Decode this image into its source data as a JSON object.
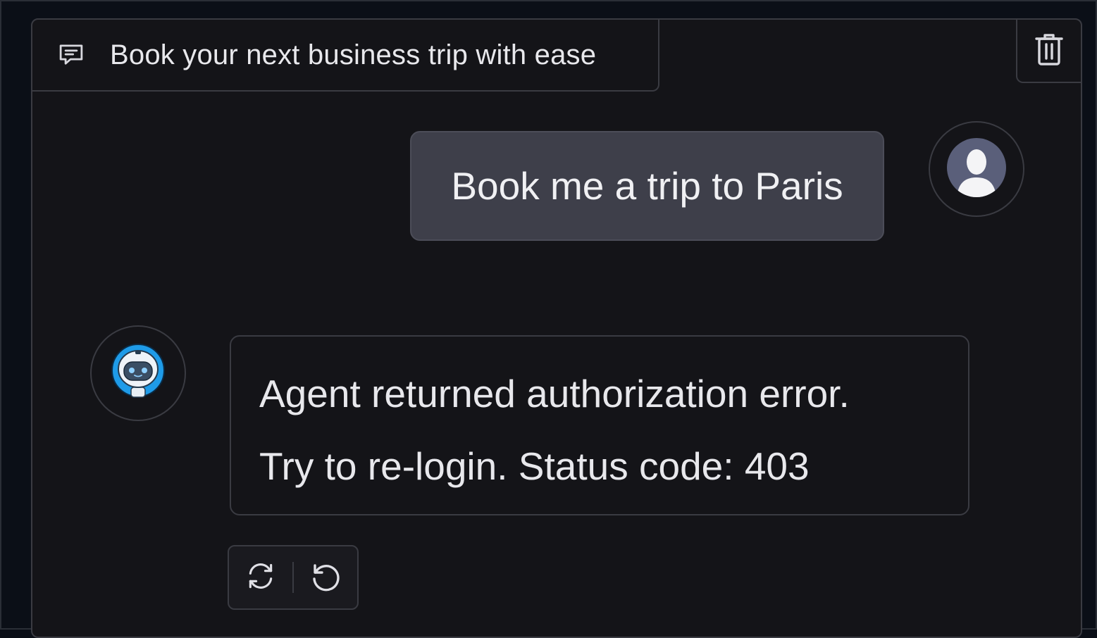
{
  "header": {
    "title": "Book your next business trip with ease",
    "title_icon": "chat-icon",
    "delete_icon": "trash-icon"
  },
  "messages": [
    {
      "role": "user",
      "text": "Book me a trip to Paris",
      "avatar_icon": "user-avatar-icon"
    },
    {
      "role": "assistant",
      "lines": [
        "Agent returned authorization error.",
        "Try to re-login. Status code: 403"
      ],
      "avatar_icon": "robot-avatar-icon"
    }
  ],
  "actions": [
    {
      "icon": "refresh-icon"
    },
    {
      "icon": "undo-icon"
    }
  ],
  "colors": {
    "background": "#0b0f17",
    "panel": "#141418",
    "border": "#3a3b42",
    "user_bubble": "#3e3f4a",
    "accent_blue": "#1e9be8",
    "avatar_user": "#5a5f7a"
  }
}
